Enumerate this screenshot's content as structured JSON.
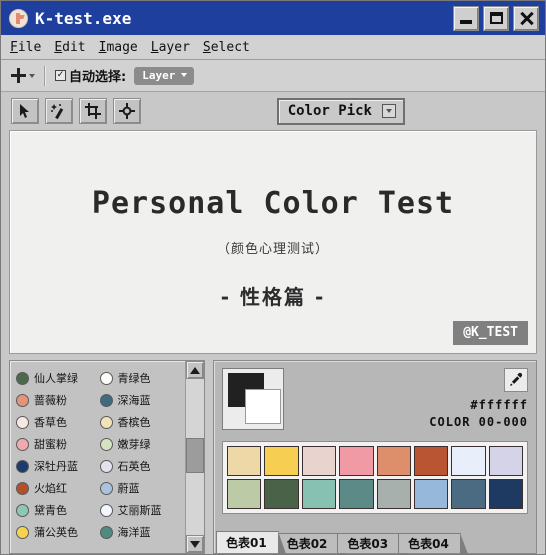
{
  "window": {
    "title": "K-test.exe",
    "icon": "app-k-icon",
    "titlebar_color": "#1f3f9e",
    "controls": [
      {
        "name": "minimize",
        "glyph": "minimize-icon"
      },
      {
        "name": "maximize",
        "glyph": "maximize-icon"
      },
      {
        "name": "close",
        "glyph": "close-icon"
      }
    ]
  },
  "menubar": {
    "items": [
      {
        "label": "File",
        "accel": "F"
      },
      {
        "label": "Edit",
        "accel": "E"
      },
      {
        "label": "Image",
        "accel": "I"
      },
      {
        "label": "Layer",
        "accel": "L"
      },
      {
        "label": "Select",
        "accel": "S"
      }
    ]
  },
  "optionsbar": {
    "move_tool_icon": "move-icon",
    "auto_select_checked": true,
    "auto_select_label": "自动选择:",
    "layer_dropdown_value": "Layer"
  },
  "toolbar": {
    "tools": [
      {
        "name": "pointer-tool",
        "icon": "cursor-arrow-icon"
      },
      {
        "name": "magic-wand-tool",
        "icon": "magic-wand-icon"
      },
      {
        "name": "crop-tool",
        "icon": "crop-icon"
      },
      {
        "name": "move-target-tool",
        "icon": "move-target-icon"
      }
    ],
    "color_pick_label": "Color Pick"
  },
  "canvas": {
    "title": "Personal Color Test",
    "subtitle": "（颜色心理测试）",
    "section": "- 性格篇 -",
    "badge": "@K_TEST",
    "background": "#f0f0ee"
  },
  "color_list": {
    "items": [
      {
        "label": "仙人掌绿",
        "color": "#4b6a4b"
      },
      {
        "label": "青绿色",
        "color": "#fbfbf7"
      },
      {
        "label": "蔷薇粉",
        "color": "#e59479"
      },
      {
        "label": "深海蓝",
        "color": "#3e6b7d"
      },
      {
        "label": "香草色",
        "color": "#f7e8e4"
      },
      {
        "label": "香槟色",
        "color": "#f2e3b8"
      },
      {
        "label": "甜蜜粉",
        "color": "#f0a9ae"
      },
      {
        "label": "嫩芽绿",
        "color": "#d5e3c0"
      },
      {
        "label": "深牡丹蓝",
        "color": "#1d3a6e"
      },
      {
        "label": "石英色",
        "color": "#e4e2ef"
      },
      {
        "label": "火焰红",
        "color": "#b3502c"
      },
      {
        "label": "蔚蓝",
        "color": "#a9c4dc"
      },
      {
        "label": "黛青色",
        "color": "#8cc9b4"
      },
      {
        "label": "艾丽斯蓝",
        "color": "#f3f8ff"
      },
      {
        "label": "蒲公英色",
        "color": "#f6d34e"
      },
      {
        "label": "海洋蓝",
        "color": "#4f8a84"
      }
    ]
  },
  "color_panel": {
    "foreground": "#212121",
    "background": "#ffffff",
    "eyedropper_icon": "eyedropper-icon",
    "hex_value": "#ffffff",
    "color_code": "COLOR 00-000",
    "swatches": [
      "#efd8a8",
      "#f6cf52",
      "#e8d3cf",
      "#ef9aa4",
      "#dd8e6b",
      "#ba5533",
      "#e8eefa",
      "#d5d3e8",
      "#bccaa6",
      "#4a6348",
      "#86c1b2",
      "#5c8a86",
      "#a8b0ae",
      "#96b8da",
      "#4b6b82",
      "#1e3a62"
    ],
    "tabs": [
      {
        "label": "色表01",
        "active": true
      },
      {
        "label": "色表02",
        "active": false
      },
      {
        "label": "色表03",
        "active": false
      },
      {
        "label": "色表04",
        "active": false
      }
    ]
  }
}
